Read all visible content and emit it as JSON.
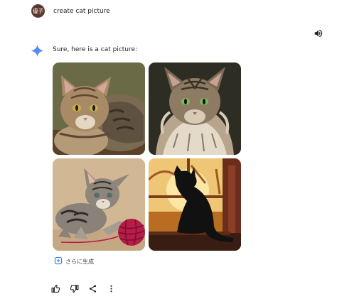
{
  "user": {
    "avatar_text": "優子",
    "prompt": "create cat picture"
  },
  "response": {
    "text": "Sure, here is a cat picture:"
  },
  "images": [
    {
      "name": "tabby cat lying"
    },
    {
      "name": "long-haired maine coon cat"
    },
    {
      "name": "tabby kitten with red yarn ball"
    },
    {
      "name": "black cat silhouette at window"
    }
  ],
  "more_button": {
    "label": "さらに生成",
    "icon": "regenerate-icon"
  },
  "actions": [
    {
      "icon": "thumbs-up-icon"
    },
    {
      "icon": "thumbs-down-icon"
    },
    {
      "icon": "share-icon"
    },
    {
      "icon": "more-vert-icon"
    }
  ],
  "colors": {
    "avatar_bg": "#5b3a2e",
    "sparkle_blue": "#4285f4",
    "text": "#1f1f1f",
    "muted": "#444746"
  }
}
